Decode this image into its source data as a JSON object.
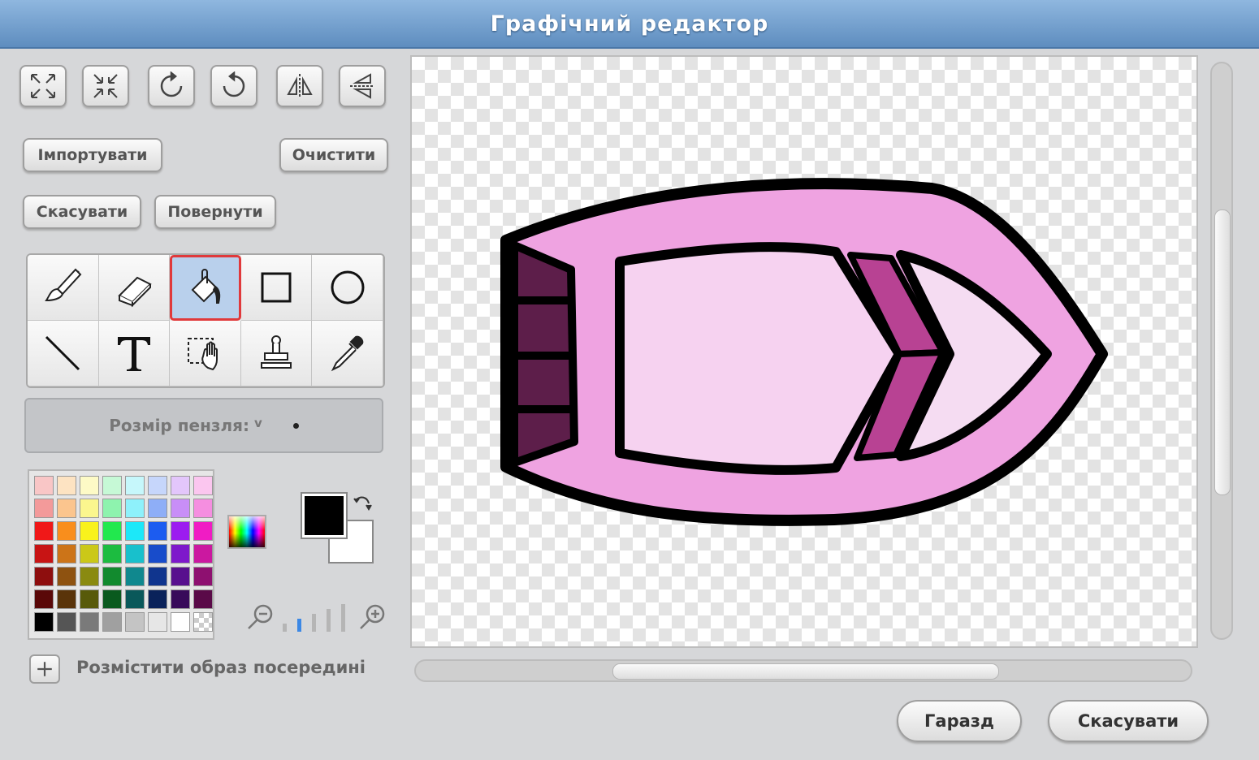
{
  "window": {
    "title": "Графічний редактор"
  },
  "toolbar": {
    "import_label": "Імпортувати",
    "clear_label": "Очистити",
    "undo_label": "Скасувати",
    "redo_label": "Повернути"
  },
  "transform_buttons": [
    "grow-icon",
    "shrink-icon",
    "rotate-left-icon",
    "rotate-right-icon",
    "flip-horizontal-icon",
    "flip-vertical-icon"
  ],
  "tools": [
    "brush-icon",
    "eraser-icon",
    "fill-bucket-icon",
    "rectangle-icon",
    "ellipse-icon",
    "line-icon",
    "text-icon",
    "select-icon",
    "stamp-icon",
    "eyedropper-icon"
  ],
  "selected_tool": "fill-bucket-icon",
  "brush": {
    "label": "Розмір пензля:",
    "arrow": "v"
  },
  "palette": {
    "colors": [
      "#f9c6c6",
      "#fde3c2",
      "#fdfac6",
      "#c6f9d6",
      "#c6f7fb",
      "#c6d6fb",
      "#e3c6fb",
      "#fbc6ef",
      "#f39a9a",
      "#fbc58e",
      "#fbf68e",
      "#8ef3ae",
      "#8ef1fb",
      "#8eaef7",
      "#c88ef7",
      "#f58ee0",
      "#f01818",
      "#f98e1c",
      "#f9f21c",
      "#22e84e",
      "#1ce8f9",
      "#1c5cf0",
      "#9c1cf0",
      "#f01cc4",
      "#c81414",
      "#cc7418",
      "#cbc818",
      "#1cbc40",
      "#18c0cc",
      "#184ccb",
      "#7e18cb",
      "#cb18a0",
      "#8e0e0e",
      "#8e5210",
      "#8a8a10",
      "#128a2e",
      "#10888e",
      "#10358e",
      "#58108e",
      "#8e1070",
      "#5a0808",
      "#5a340a",
      "#585a0a",
      "#0a5a1e",
      "#0a585a",
      "#0a225a",
      "#380a5a",
      "#5a0a48",
      "#000000",
      "#555555",
      "#7a7a7a",
      "#a0a0a0",
      "#c4c4c4",
      "#e6e6e6",
      "#ffffff",
      "checker"
    ],
    "foreground": "#000000",
    "background": "#ffffff"
  },
  "center_label": "Розмістити образ посередині",
  "footer": {
    "ok_label": "Гаразд",
    "cancel_label": "Скасувати"
  },
  "costume": {
    "outline": "#000000",
    "hull": "#efa3e1",
    "deck": "#f6d2f0",
    "bow": "#f5dcf2",
    "seat": "#b84293",
    "stern": "#5d1e4a"
  }
}
